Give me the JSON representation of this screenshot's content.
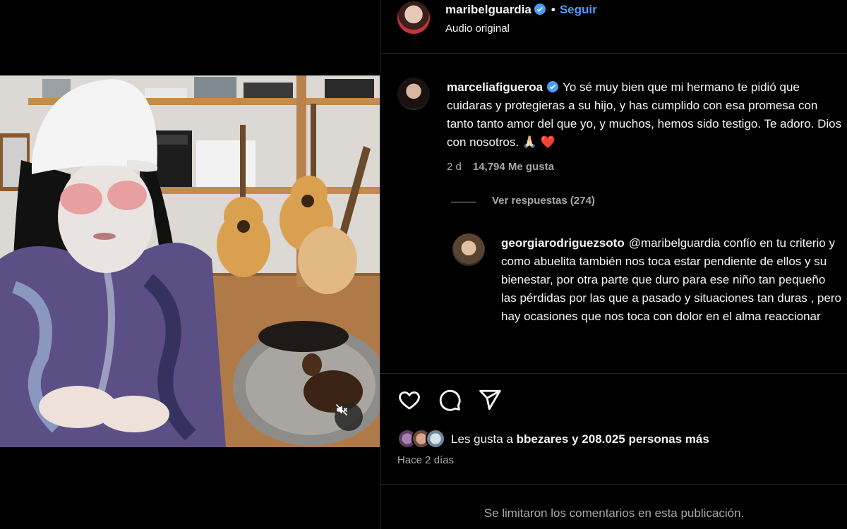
{
  "header": {
    "username": "maribelguardia",
    "separator": "•",
    "follow_label": "Seguir",
    "audio_label": "Audio original"
  },
  "comments": [
    {
      "username": "marceliafigueroa",
      "verified": true,
      "text": "Yo sé muy bien que mi hermano te pidió que cuidaras y protegieras a su hijo, y has cumplido con esa promesa con tanto tanto amor del que yo, y muchos, hemos sido testigo. Te adoro. Dios con nosotros. 🙏🏻 ❤️",
      "time": "2 d",
      "likes": "14,794 Me gusta",
      "replies_label": "Ver respuestas (274)"
    },
    {
      "username": "georgiarodriguezsoto",
      "verified": false,
      "text": "@maribelguardia confío en tu criterio y como abuelita también nos toca estar pendiente de ellos y su bienestar, por otra parte que duro para ese niño tan pequeño las pérdidas por las que a pasado y situaciones tan duras , pero hay ocasiones que nos toca con dolor en el alma reaccionar"
    }
  ],
  "actions": {
    "like_icon": "heart-icon",
    "comment_icon": "comment-icon",
    "share_icon": "send-icon"
  },
  "likes": {
    "prefix": "Les gusta a",
    "first_liker": "bbezares",
    "conjunction": "y",
    "others": "208.025 personas más"
  },
  "time_ago": "Hace 2 días",
  "comments_limited": "Se limitaron los comentarios en esta publicación.",
  "colors": {
    "background": "#000000",
    "text": "#f5f5f5",
    "secondary": "#a8a8a8",
    "link": "#4a9df8",
    "divider": "#262626",
    "heart": "#ed4956"
  }
}
